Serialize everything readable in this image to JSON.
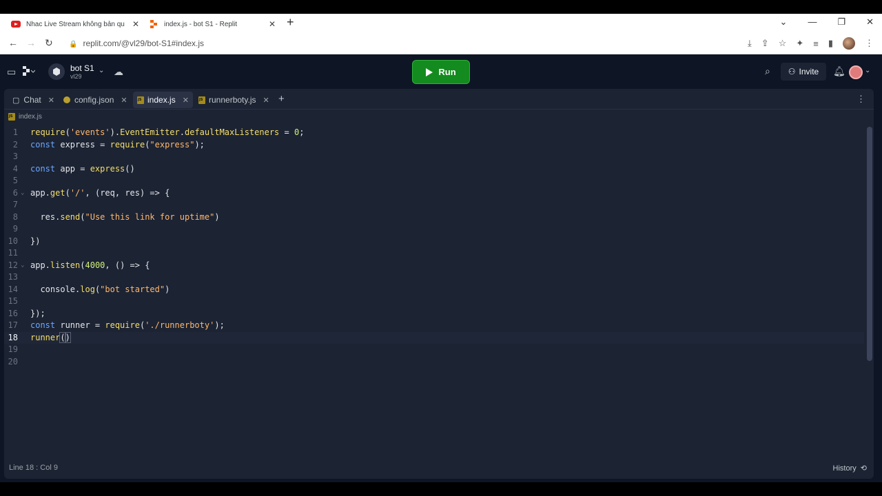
{
  "browser": {
    "tabs": [
      {
        "title": "Nhac Live Stream không bản qu",
        "favicon": "youtube-icon"
      },
      {
        "title": "index.js - bot S1 - Replit",
        "favicon": "replit-icon"
      }
    ],
    "url": "replit.com/@vl29/bot-S1#index.js"
  },
  "header": {
    "repl_name": "bot S1",
    "repl_user": "vl29",
    "run_label": "Run",
    "invite_label": "Invite"
  },
  "editor": {
    "tabs": [
      {
        "label": "Chat",
        "icon": "chat-icon"
      },
      {
        "label": "config.json",
        "icon": "json-file-icon"
      },
      {
        "label": "index.js",
        "icon": "js-file-icon",
        "active": true
      },
      {
        "label": "runnerboty.js",
        "icon": "js-file-icon"
      }
    ],
    "breadcrumb": "index.js",
    "line_numbers": [
      "1",
      "2",
      "3",
      "4",
      "5",
      "6",
      "7",
      "8",
      "9",
      "10",
      "11",
      "12",
      "13",
      "14",
      "15",
      "16",
      "17",
      "18",
      "19",
      "20"
    ],
    "current_line": 18,
    "status": "Line 18 : Col 9",
    "history_label": "History"
  },
  "colors": {
    "background": "#0e1525",
    "pane": "#1c2333",
    "run_button": "#148b1e",
    "keyword": "#6da8ff",
    "function": "#f5df6b",
    "string": "#ffb86c",
    "number": "#d2f07a"
  }
}
